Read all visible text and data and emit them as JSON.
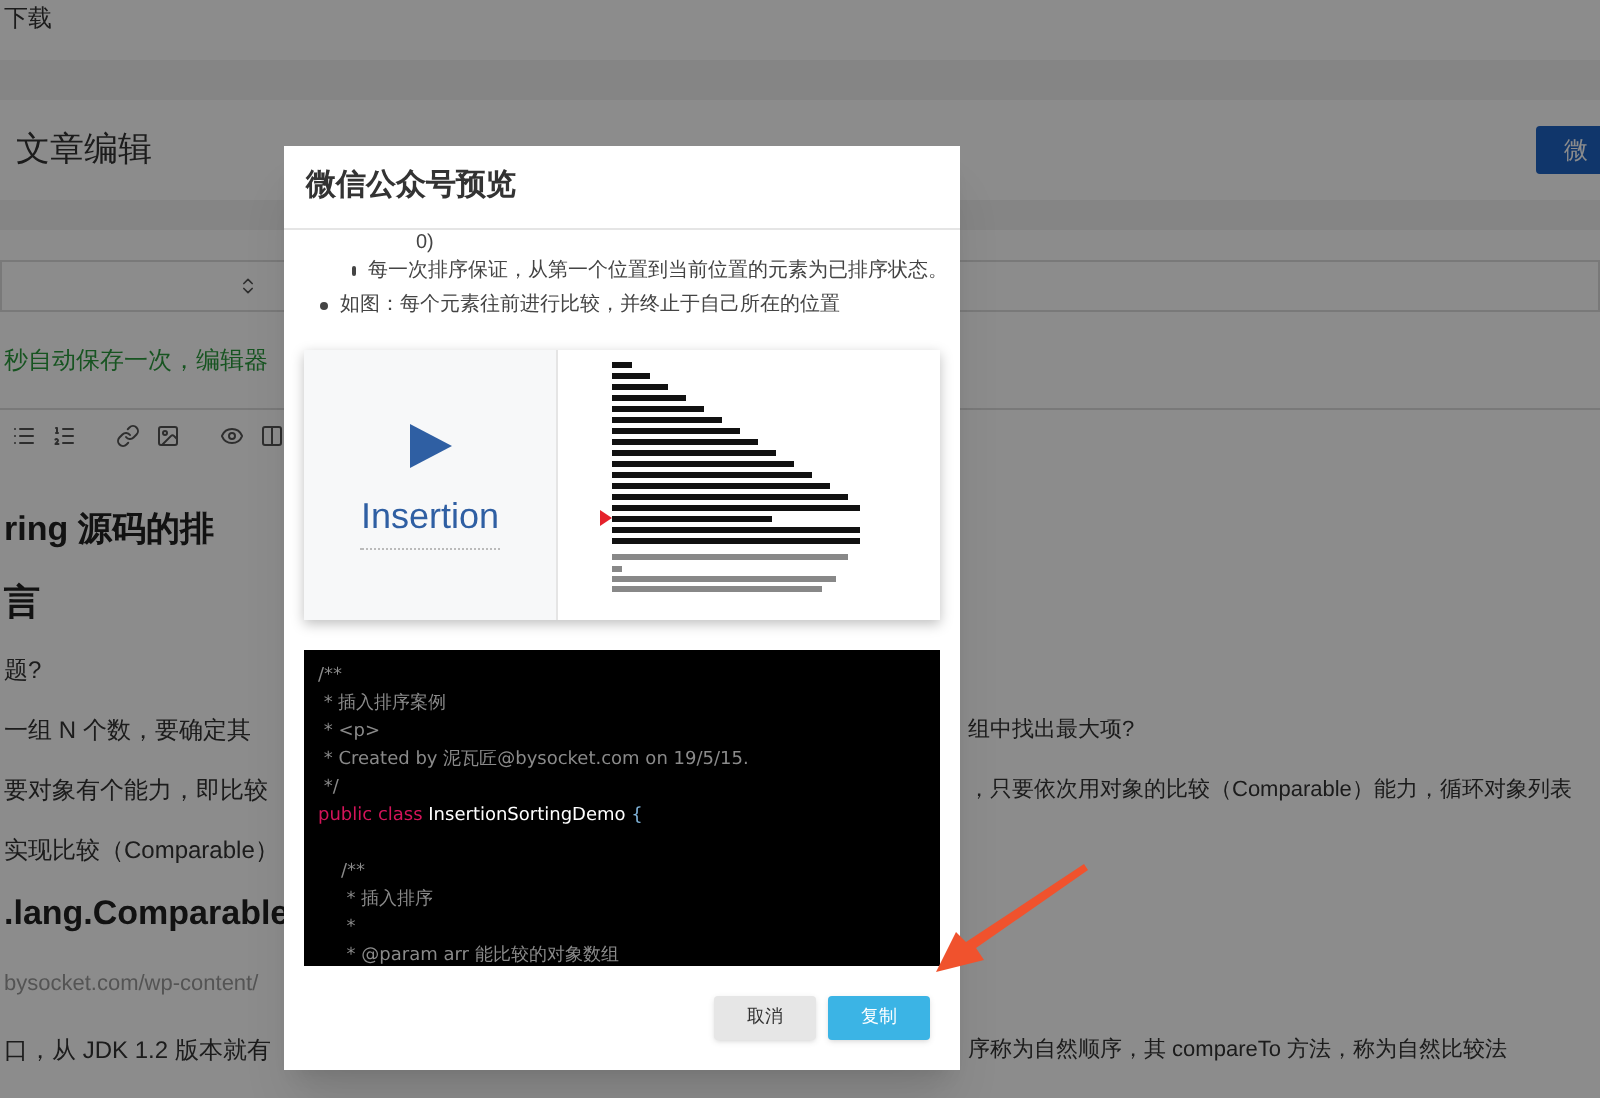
{
  "page": {
    "top_link": "下载",
    "header_title": "文章编辑",
    "header_button": "微",
    "autosave_note": "秒自动保存一次，编辑器",
    "article": [
      {
        "kind": "heading",
        "left": "ring 源码的排"
      },
      {
        "kind": "subheading",
        "left": "言"
      },
      {
        "kind": "text",
        "left": "题?"
      },
      {
        "kind": "text",
        "left": "一组 N 个数，要确定其",
        "right": "组中找出最大项?"
      },
      {
        "kind": "text",
        "left": "要对象有个能力，即比较",
        "right": "，只要依次用对象的比较（Comparable）能力，循环对象列表"
      },
      {
        "kind": "text",
        "left": "实现比较（Comparable）"
      },
      {
        "kind": "heading",
        "left": ".lang.Comparable"
      },
      {
        "kind": "link",
        "left": "bysocket.com/wp-content/"
      },
      {
        "kind": "text",
        "left": "口，从 JDK 1.2 版本就有",
        "right": "序称为自然顺序，其 compareTo 方法，称为自然比较法"
      }
    ]
  },
  "dialog": {
    "title": "微信公众号预览",
    "list": [
      {
        "kind": "fragment",
        "text": "0)"
      },
      {
        "kind": "sub",
        "text": "每一次排序保证，从第一个位置到当前位置的元素为已排序状态。"
      },
      {
        "kind": "bullet",
        "text": "如图：每个元素往前进行比较，并终止于自己所在的位置"
      }
    ],
    "figure_label": "Insertion",
    "code": [
      {
        "tokens": [
          {
            "kind": "comment",
            "text": "/**"
          }
        ]
      },
      {
        "tokens": [
          {
            "kind": "comment",
            "text": " * 插入排序案例"
          }
        ]
      },
      {
        "tokens": [
          {
            "kind": "comment",
            "text": " * <p>"
          }
        ]
      },
      {
        "tokens": [
          {
            "kind": "comment",
            "text": " * Created by 泥瓦匠@bysocket.com on 19/5/15."
          }
        ]
      },
      {
        "tokens": [
          {
            "kind": "comment",
            "text": " */"
          }
        ]
      },
      {
        "tokens": [
          {
            "kind": "keyword",
            "text": "public class "
          },
          {
            "kind": "name",
            "text": "InsertionSortingDemo"
          },
          {
            "kind": "punct",
            "text": " {"
          }
        ]
      },
      {
        "gap_before": true,
        "tokens": [
          {
            "kind": "comment",
            "text": "    /**"
          }
        ]
      },
      {
        "tokens": [
          {
            "kind": "comment",
            "text": "     * 插入排序"
          }
        ]
      },
      {
        "tokens": [
          {
            "kind": "comment",
            "text": "     *"
          }
        ]
      },
      {
        "tokens": [
          {
            "kind": "comment",
            "text": "     * @param arr 能比较的对象数组"
          }
        ]
      }
    ],
    "buttons": [
      {
        "label": "取消",
        "kind": "secondary"
      },
      {
        "label": "复制",
        "kind": "primary"
      }
    ]
  }
}
